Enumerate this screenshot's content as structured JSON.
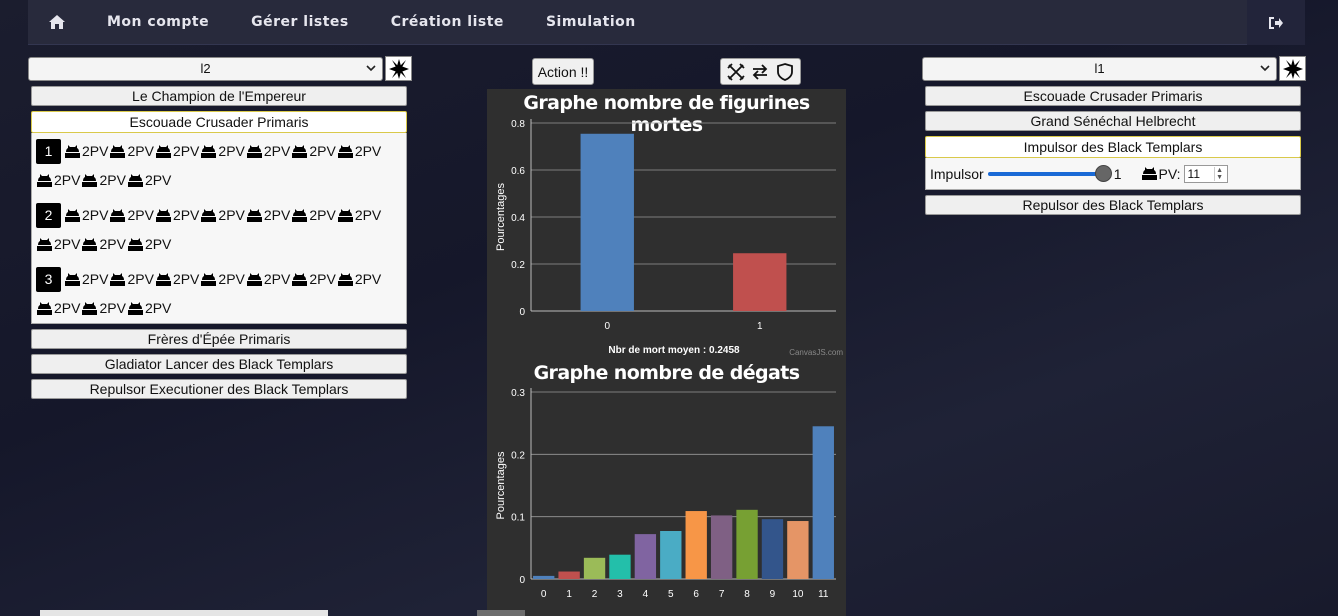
{
  "nav": {
    "items": [
      "Mon compte",
      "Gérer listes",
      "Création liste",
      "Simulation"
    ],
    "home_icon": "home-icon",
    "logout_icon": "logout-icon"
  },
  "left": {
    "selected_list": "l2",
    "units": [
      "Le Champion de l'Empereur",
      "Escouade Crusader Primaris",
      "Frères d'Épée Primaris",
      "Gladiator Lancer des Black Templars",
      "Repulsor Executioner des Black Templars"
    ],
    "active_unit_index": 1,
    "groups": [
      {
        "number": "1",
        "pv": [
          "2PV",
          "2PV",
          "2PV",
          "2PV",
          "2PV",
          "2PV",
          "2PV",
          "2PV",
          "2PV",
          "2PV"
        ]
      },
      {
        "number": "2",
        "pv": [
          "2PV",
          "2PV",
          "2PV",
          "2PV",
          "2PV",
          "2PV",
          "2PV",
          "2PV",
          "2PV",
          "2PV"
        ]
      },
      {
        "number": "3",
        "pv": [
          "2PV",
          "2PV",
          "2PV",
          "2PV",
          "2PV",
          "2PV",
          "2PV",
          "2PV",
          "2PV",
          "2PV"
        ]
      }
    ]
  },
  "center": {
    "action_label": "Action !!",
    "tool_icons": [
      "swords-icon",
      "swap-icon",
      "shield-icon"
    ]
  },
  "right": {
    "selected_list": "l1",
    "units": [
      "Escouade Crusader Primaris",
      "Grand Sénéchal Helbrecht",
      "Impulsor des Black Templars",
      "Repulsor des Black Templars"
    ],
    "active_unit_index": 2,
    "impulsor": {
      "label": "Impulsor",
      "slider_value": "1",
      "pv_label": "PV:",
      "pv_value": "11"
    }
  },
  "chart_data": [
    {
      "type": "bar",
      "title": "Graphe nombre de figurines mortes",
      "ylabel": "Pourcentages",
      "xlabel": "",
      "categories": [
        "0",
        "1"
      ],
      "values": [
        0.7542,
        0.2458
      ],
      "colors": [
        "#4f81bc",
        "#c0504e"
      ],
      "ylim": [
        0,
        0.8
      ],
      "yticks": [
        "0",
        "0.2",
        "0.4",
        "0.6",
        "0.8"
      ],
      "annotation": "Nbr de mort moyen : 0.2458",
      "credit": "CanvasJS.com"
    },
    {
      "type": "bar",
      "title": "Graphe nombre de dégats",
      "ylabel": "Pourcentages",
      "xlabel": "",
      "categories": [
        "0",
        "1",
        "2",
        "3",
        "4",
        "5",
        "6",
        "7",
        "8",
        "9",
        "10",
        "11"
      ],
      "values": [
        0.005,
        0.012,
        0.034,
        0.039,
        0.072,
        0.077,
        0.109,
        0.102,
        0.111,
        0.096,
        0.093,
        0.245
      ],
      "colors": [
        "#4f81bc",
        "#c0504e",
        "#9bbb58",
        "#23bfaa",
        "#8064a1",
        "#4aacc5",
        "#f79647",
        "#7f6084",
        "#77a033",
        "#33558b",
        "#e59566",
        "#4f81bc"
      ],
      "ylim": [
        0,
        0.3
      ],
      "yticks": [
        "0",
        "0.1",
        "0.2",
        "0.3"
      ]
    }
  ]
}
